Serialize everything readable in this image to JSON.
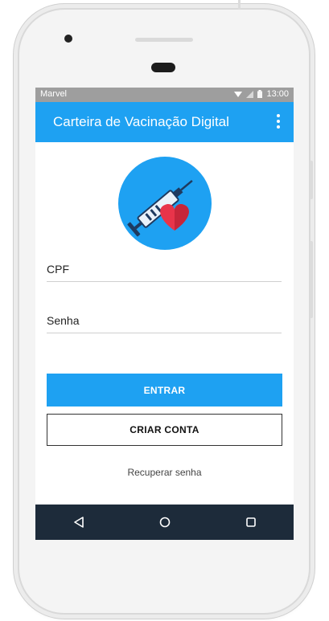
{
  "status_bar": {
    "carrier": "Marvel",
    "time": "13:00"
  },
  "app_bar": {
    "title": "Carteira de Vacinação Digital",
    "menu_icon": "more-vert-icon"
  },
  "logo": {
    "icon": "syringe-heart-icon"
  },
  "form": {
    "cpf": {
      "label": "CPF",
      "value": ""
    },
    "senha": {
      "label": "Senha",
      "value": ""
    }
  },
  "actions": {
    "login_label": "ENTRAR",
    "create_account_label": "CRIAR CONTA",
    "recover_password_label": "Recuperar senha"
  },
  "nav_bar": {
    "back_icon": "back-icon",
    "home_icon": "home-icon",
    "recents_icon": "recents-icon"
  },
  "colors": {
    "primary": "#1ea1f2",
    "status_bar": "#9e9e9e",
    "nav_bar": "#1d2b3a",
    "heart": "#e8344a"
  }
}
